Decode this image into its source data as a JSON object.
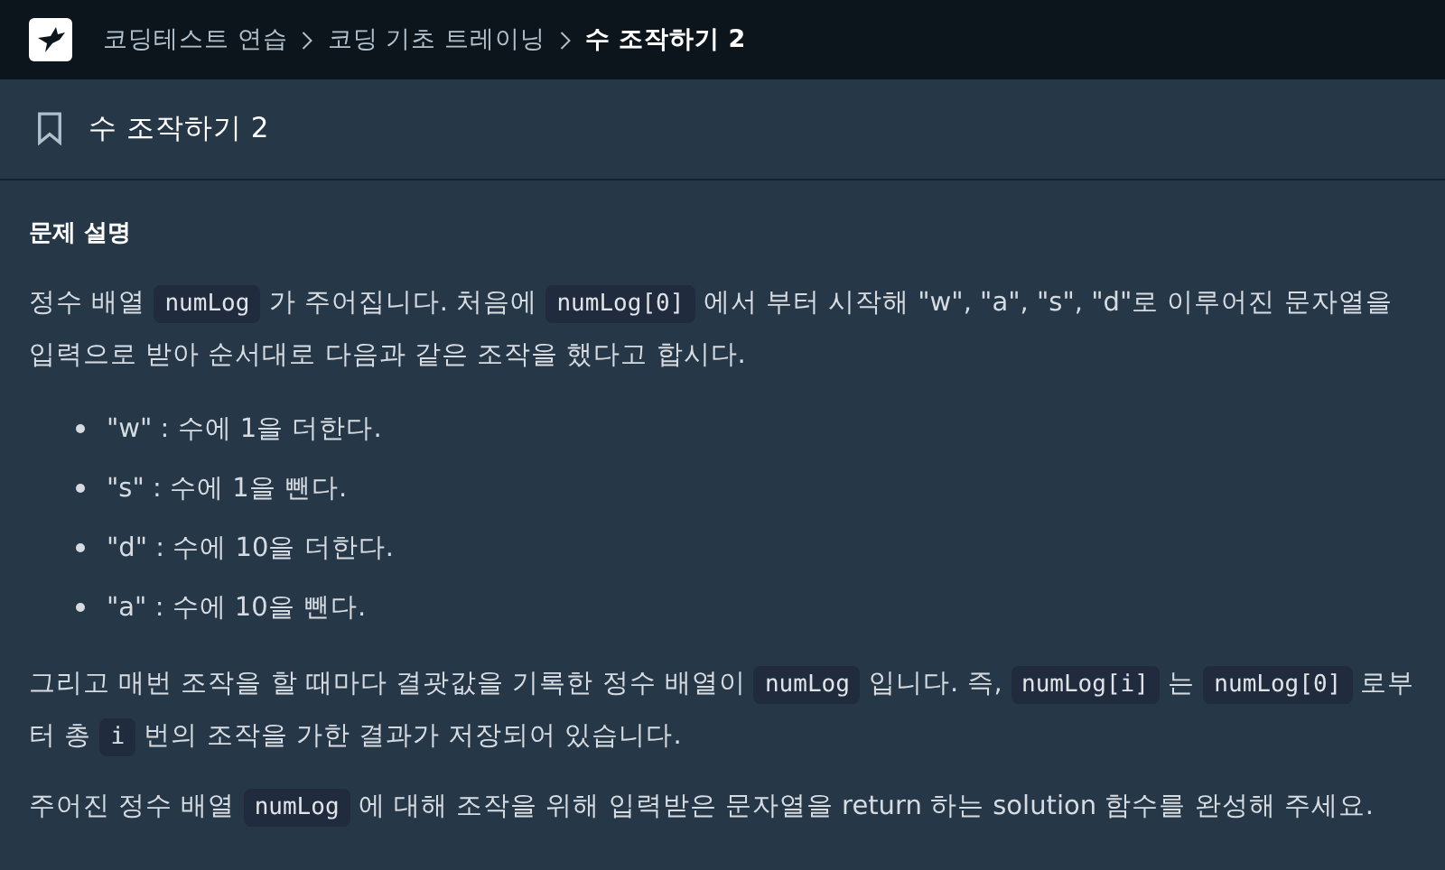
{
  "breadcrumb": [
    {
      "label": "코딩테스트 연습",
      "current": false
    },
    {
      "label": "코딩 기초 트레이닝",
      "current": false
    },
    {
      "label": "수 조작하기 2",
      "current": true
    }
  ],
  "header": {
    "title": "수 조작하기 2"
  },
  "section_title": "문제 설명",
  "paragraphs": [
    [
      {
        "kind": "text",
        "text": "정수 배열 "
      },
      {
        "kind": "code",
        "text": "numLog"
      },
      {
        "kind": "text",
        "text": " 가 주어집니다. 처음에 "
      },
      {
        "kind": "code",
        "text": "numLog[0]"
      },
      {
        "kind": "text",
        "text": " 에서 부터 시작해 \"w\", \"a\", \"s\", \"d\"로 이루어진 문자열을 입력으로 받아 순서대로 다음과 같은 조작을 했다고 합시다."
      }
    ],
    {
      "list": [
        "\"w\" : 수에 1을 더한다.",
        "\"s\" : 수에 1을 뺀다.",
        "\"d\" : 수에 10을 더한다.",
        "\"a\" : 수에 10을 뺀다."
      ]
    },
    [
      {
        "kind": "text",
        "text": "그리고 매번 조작을 할 때마다 결괏값을 기록한 정수 배열이 "
      },
      {
        "kind": "code",
        "text": "numLog"
      },
      {
        "kind": "text",
        "text": " 입니다. 즉, "
      },
      {
        "kind": "code",
        "text": "numLog[i]"
      },
      {
        "kind": "text",
        "text": " 는 "
      },
      {
        "kind": "code",
        "text": "numLog[0]"
      },
      {
        "kind": "text",
        "text": " 로부터 총 "
      },
      {
        "kind": "code",
        "text": "i"
      },
      {
        "kind": "text",
        "text": " 번의 조작을 가한 결과가 저장되어 있습니다."
      }
    ],
    [
      {
        "kind": "text",
        "text": "주어진 정수 배열 "
      },
      {
        "kind": "code",
        "text": "numLog"
      },
      {
        "kind": "text",
        "text": " 에 대해 조작을 위해 입력받은 문자열을 return 하는 solution 함수를 완성해 주세요."
      }
    ]
  ]
}
